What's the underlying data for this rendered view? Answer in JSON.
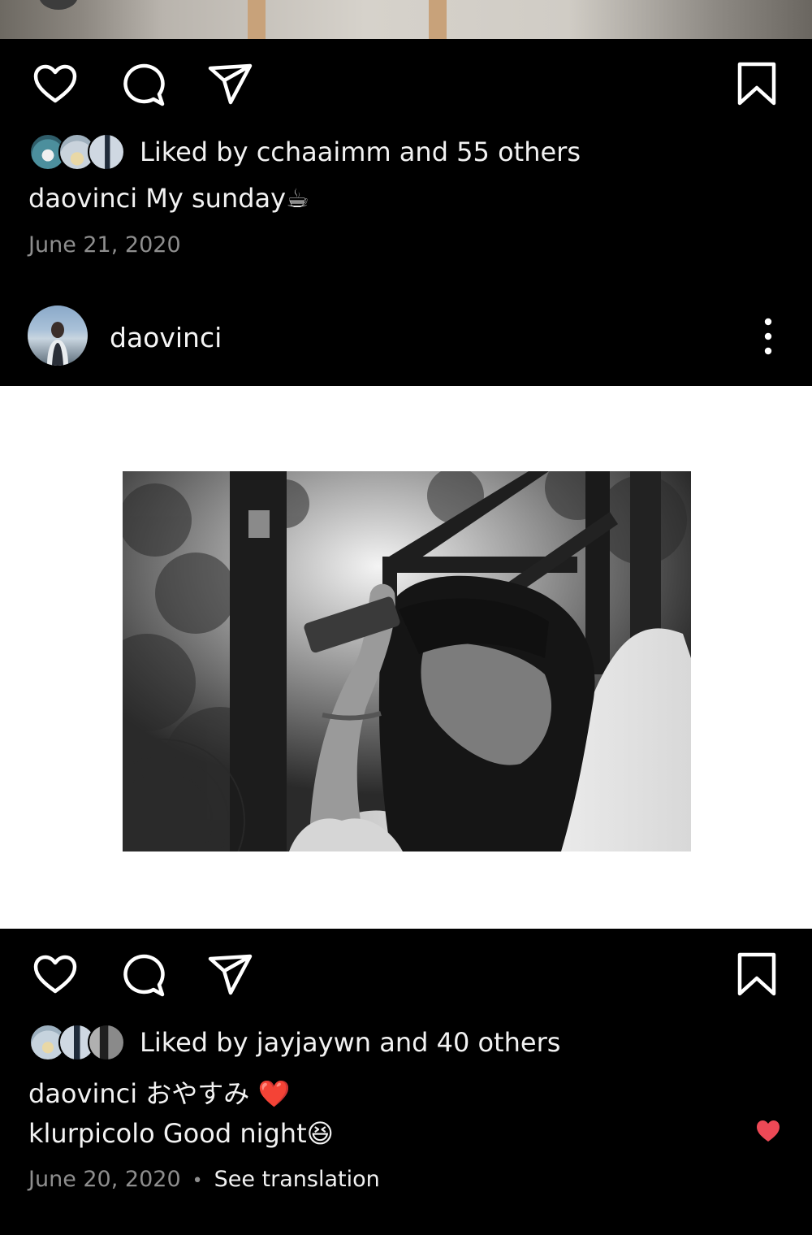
{
  "post1": {
    "likes_text": "Liked by cchaaimm and 55 others",
    "caption_user": "daovinci",
    "caption_text": "My sunday",
    "caption_emoji": "☕",
    "date": "June 21, 2020"
  },
  "post2": {
    "username": "daovinci",
    "likes_text": "Liked by jayjaywn and 40 others",
    "caption_user": "daovinci",
    "caption_text": "おやすみ",
    "caption_emoji": "❤️",
    "comment_user": "klurpicolo",
    "comment_text": "Good night",
    "comment_emoji": "😆",
    "date": "June 20, 2020",
    "date_separator": "•",
    "see_translation": "See translation"
  },
  "icons": {
    "like": "heart-outline-icon",
    "comment": "comment-bubble-icon",
    "share": "paper-plane-icon",
    "save": "bookmark-icon",
    "more": "more-vertical-icon",
    "comment_like": "heart-filled-icon"
  },
  "colors": {
    "background": "#000000",
    "text": "#f2f2f2",
    "muted": "#8e8e8e",
    "heart_red": "#ed4956"
  }
}
